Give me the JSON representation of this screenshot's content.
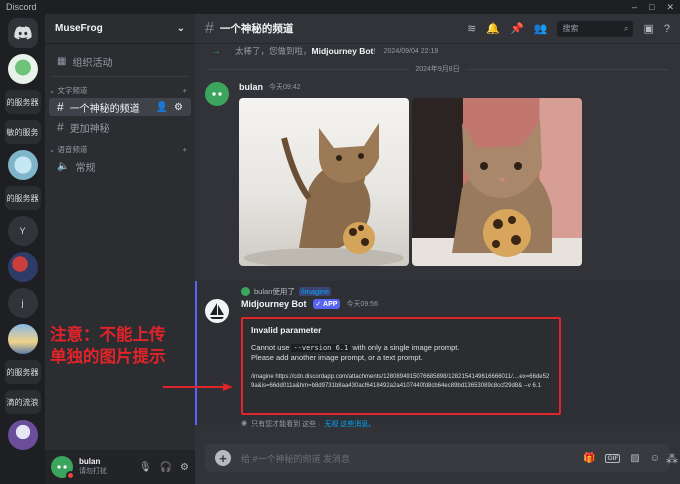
{
  "window": {
    "title": "Discord",
    "controls": [
      "–",
      "□",
      "✕"
    ]
  },
  "servers": [
    {
      "kind": "home",
      "icon": "discord-logo-icon"
    },
    {
      "kind": "image",
      "style": "img1",
      "icon": "speaker-icon"
    },
    {
      "kind": "text",
      "label": "的服务器"
    },
    {
      "kind": "text",
      "label": "敏的服务"
    },
    {
      "kind": "image",
      "style": "img2"
    },
    {
      "kind": "text",
      "label": "的服务器"
    },
    {
      "kind": "letter",
      "label": "Y"
    },
    {
      "kind": "image",
      "style": "img3"
    },
    {
      "kind": "letter",
      "label": "j"
    },
    {
      "kind": "image",
      "style": "img4"
    },
    {
      "kind": "text",
      "label": "的服务器"
    },
    {
      "kind": "text",
      "label": "滴的流浪"
    },
    {
      "kind": "image",
      "style": "img5"
    }
  ],
  "guild": {
    "name": "MuseFrog",
    "events": "组织活动",
    "categories": [
      {
        "name": "文字频道",
        "channels": [
          {
            "name": "一个神秘的频道",
            "type": "text",
            "active": true
          },
          {
            "name": "更加神秘",
            "type": "text",
            "active": false
          }
        ]
      },
      {
        "name": "语音频道",
        "channels": [
          {
            "name": "常规",
            "type": "voice",
            "active": false
          }
        ]
      }
    ]
  },
  "user": {
    "name": "bulan",
    "status": "请勿打扰"
  },
  "topbar": {
    "channel": "一个神秘的频道",
    "search_placeholder": "搜索"
  },
  "messages": {
    "system": {
      "text": "太棒了，您做到啦，",
      "name": "Midjourney Bot",
      "suffix": "!",
      "time": "2024/09/04 22:19"
    },
    "date_divider": "2024年9月8日",
    "user_msg": {
      "author": "bulan",
      "time": "今天09:42"
    },
    "reply": {
      "user": "bulan使用了",
      "command": "/imagine"
    },
    "bot_msg": {
      "author": "Midjourney Bot",
      "badge": "✓ APP",
      "time": "今天09:56",
      "error_title": "Invalid parameter",
      "error_line1_pre": "Cannot use ",
      "error_code": "--version 6.1",
      "error_line1_post": " with only a single image prompt.",
      "error_line2": "Please add another image prompt, or a text prompt.",
      "error_url": "/imagine https://cdn.discordapp.com/attachments/1280894915076685898/1282154149616666011/....ex=66de529a&is=66dd011a&hm=b8d9731b8aa430acf6418492a2a4107440fd8cb64ec89bd13653089c8ccf29d8& --v 6.1",
      "ephemeral_pre": "只有您才能看到 这些 · ",
      "ephemeral_link": "无视 这些消息。"
    }
  },
  "annotation": {
    "line1": "注意：不能上传",
    "line2": "单独的图片提示"
  },
  "composer": {
    "placeholder": "给 #一个神秘的频道 发消息"
  },
  "colors": {
    "accent": "#5865f2",
    "error_border": "#e0242a",
    "link": "#00a8fc"
  }
}
